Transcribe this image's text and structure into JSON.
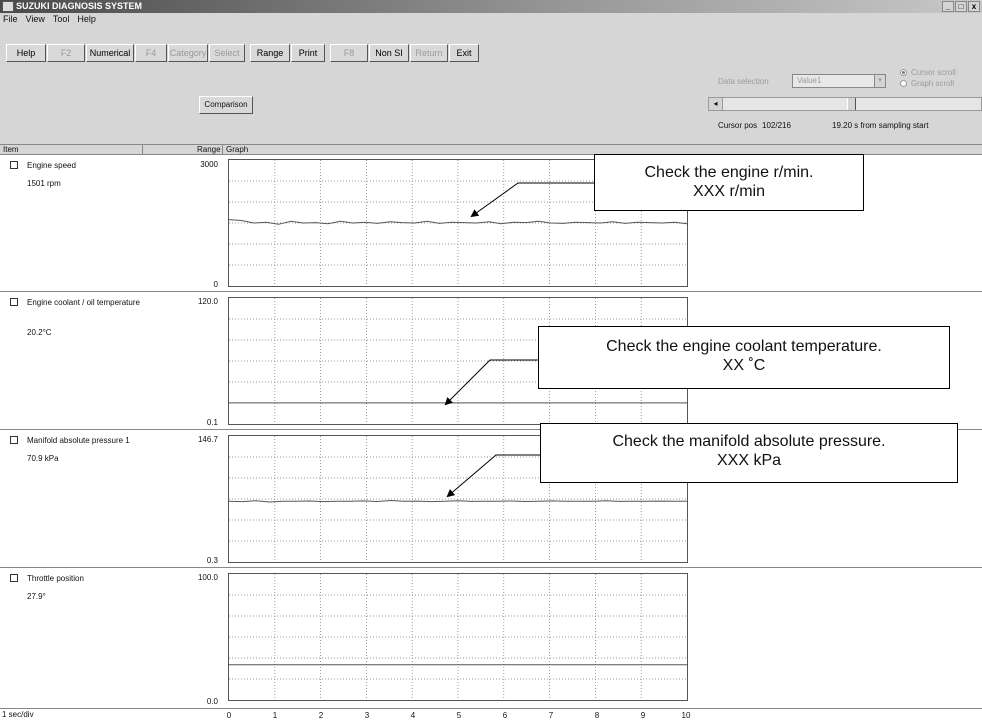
{
  "window": {
    "title": "SUZUKI DIAGNOSIS SYSTEM",
    "controls": [
      "_",
      "□",
      "x"
    ]
  },
  "menu": [
    "File",
    "View",
    "Tool",
    "Help"
  ],
  "toolbar": [
    {
      "label": "Help",
      "enabled": true
    },
    {
      "label": "F2",
      "enabled": false
    },
    {
      "label": "Numerical",
      "enabled": true
    },
    {
      "label": "F4",
      "enabled": false
    },
    {
      "label": "Category",
      "enabled": false
    },
    {
      "label": "Select",
      "enabled": false
    },
    {
      "label": "Range",
      "enabled": true
    },
    {
      "label": "Print",
      "enabled": true
    },
    {
      "label": "F8",
      "enabled": false
    },
    {
      "label": "Non SI",
      "enabled": true
    },
    {
      "label": "Return",
      "enabled": false
    },
    {
      "label": "Exit",
      "enabled": true
    }
  ],
  "panel": {
    "comparison_label": "Comparison",
    "data_selection_label": "Data selection",
    "data_selection_value": "Value1",
    "cursor_scroll_label": "Cursor scroll",
    "graph_scroll_label": "Graph scroll",
    "cursor_pos_label": "Cursor pos",
    "cursor_pos_value": "102/216",
    "sampling_text": "19.20 s from sampling start"
  },
  "columns": {
    "item": "Item",
    "range": "Range",
    "graph": "Graph"
  },
  "rows": [
    {
      "name": "Engine speed",
      "value": "1501 rpm",
      "range_max": "3000",
      "range_min": "0"
    },
    {
      "name": "Engine coolant / oil temperature",
      "value": "20.2°C",
      "range_max": "120.0",
      "range_min": "0.1"
    },
    {
      "name": "Manifold absolute pressure 1",
      "value": "70.9 kPa",
      "range_max": "146.7",
      "range_min": "0.3"
    },
    {
      "name": "Throttle position",
      "value": "27.9°",
      "range_max": "100.0",
      "range_min": "0.0"
    }
  ],
  "footer": {
    "scale": "1 sec/div"
  },
  "x_ticks": [
    "0",
    "1",
    "2",
    "3",
    "4",
    "5",
    "6",
    "7",
    "8",
    "9",
    "10"
  ],
  "callouts": [
    {
      "line1": "Check the engine r/min.",
      "line2": "XXX r/min"
    },
    {
      "line1": "Check the engine coolant temperature.",
      "line2": "XX ˚C"
    },
    {
      "line1": "Check the manifold absolute pressure.",
      "line2": "XXX kPa"
    }
  ],
  "chart_data": [
    {
      "type": "line",
      "series": [
        {
          "values": [
            1580,
            1560,
            1500,
            1520,
            1470,
            1540,
            1500,
            1510,
            1480,
            1540,
            1500,
            1520,
            1490,
            1530,
            1510,
            1500,
            1540,
            1490,
            1520,
            1510,
            1500,
            1530,
            1480,
            1520,
            1510,
            1540,
            1500,
            1490,
            1520,
            1510,
            1500,
            1530,
            1490,
            1520,
            1510,
            1500,
            1520,
            1480
          ]
        }
      ],
      "ylim": [
        0,
        3000
      ],
      "x_range": [
        0,
        10
      ]
    },
    {
      "type": "line",
      "series": [
        {
          "values": [
            20.2,
            20.2,
            20.2,
            20.2,
            20.2,
            20.2,
            20.2,
            20.2,
            20.2,
            20.2,
            20.2
          ]
        }
      ],
      "ylim": [
        0.1,
        120.0
      ],
      "x_range": [
        0,
        10
      ]
    },
    {
      "type": "line",
      "series": [
        {
          "values": [
            71,
            70.5,
            71.5,
            70,
            71,
            70.8,
            71.2,
            70.5,
            71,
            70.9,
            71.3,
            70.6,
            71.8,
            70.8,
            71.1,
            70.5,
            71,
            71.4,
            70.7,
            71,
            70.9,
            71.2,
            70.6,
            71,
            71.3,
            70.8,
            71,
            70.9,
            71.5,
            70.7,
            71,
            70.9,
            71.1,
            70.8,
            71
          ]
        }
      ],
      "ylim": [
        0.3,
        146.7
      ],
      "x_range": [
        0,
        10
      ]
    },
    {
      "type": "line",
      "series": [
        {
          "values": [
            27.9,
            27.9,
            27.9,
            27.9,
            27.9,
            27.9,
            27.9,
            27.9,
            27.9,
            27.9,
            27.9
          ]
        }
      ],
      "ylim": [
        0.0,
        100.0
      ],
      "x_range": [
        0,
        10
      ]
    }
  ]
}
